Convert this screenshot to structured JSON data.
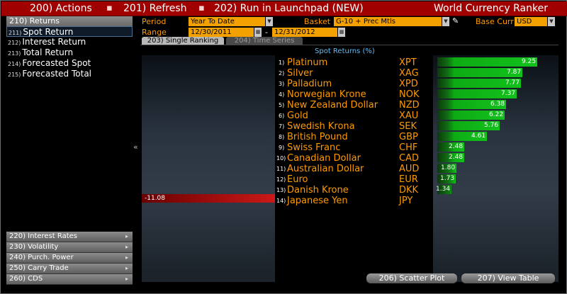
{
  "topbar": {
    "actions": "200) Actions",
    "refresh": "201) Refresh",
    "launchpad": "202) Run in Launchpad (NEW)",
    "app_title": "World Currency Ranker"
  },
  "sidebar": {
    "header": "210) Returns",
    "items": [
      {
        "num": "211)",
        "label": "Spot Return"
      },
      {
        "num": "212)",
        "label": "Interest Return"
      },
      {
        "num": "213)",
        "label": "Total Return"
      },
      {
        "num": "214)",
        "label": "Forecasted Spot"
      },
      {
        "num": "215)",
        "label": "Forecasted Total"
      }
    ],
    "bottom": [
      "220) Interest Rates",
      "230) Volatility",
      "240) Purch. Power",
      "250) Carry Trade",
      "260) CDS"
    ]
  },
  "controls": {
    "period_label": "Period",
    "period_value": "Year To Date",
    "range_label": "Range",
    "range_start": "12/30/2011",
    "range_dash": "-",
    "range_end": "12/31/2012",
    "basket_label": "Basket",
    "basket_value": "G-10 + Prec Mtls",
    "basecurr_label": "Base Curr",
    "basecurr_value": "USD"
  },
  "tabs": {
    "single": "203) Single Ranking",
    "timeseries": "204) Time Series"
  },
  "chart_data": {
    "type": "bar",
    "title": "Spot Returns (%)",
    "xlim": [
      -11.08,
      9.25
    ],
    "rows": [
      {
        "rank": "1)",
        "name": "Platinum",
        "code": "XPT",
        "value": 9.25,
        "label": "9.25"
      },
      {
        "rank": "2)",
        "name": "Silver",
        "code": "XAG",
        "value": 7.87,
        "label": "7.87"
      },
      {
        "rank": "3)",
        "name": "Palladium",
        "code": "XPD",
        "value": 7.77,
        "label": "7.77"
      },
      {
        "rank": "4)",
        "name": "Norwegian Krone",
        "code": "NOK",
        "value": 7.37,
        "label": "7.37"
      },
      {
        "rank": "5)",
        "name": "New Zealand Dollar",
        "code": "NZD",
        "value": 6.38,
        "label": "6.38"
      },
      {
        "rank": "6)",
        "name": "Gold",
        "code": "XAU",
        "value": 6.22,
        "label": "6.22"
      },
      {
        "rank": "7)",
        "name": "Swedish Krona",
        "code": "SEK",
        "value": 5.76,
        "label": "5.76"
      },
      {
        "rank": "8)",
        "name": "British Pound",
        "code": "GBP",
        "value": 4.61,
        "label": "4.61"
      },
      {
        "rank": "9)",
        "name": "Swiss Franc",
        "code": "CHF",
        "value": 2.48,
        "label": "2.48"
      },
      {
        "rank": "10)",
        "name": "Canadian Dollar",
        "code": "CAD",
        "value": 2.48,
        "label": "2.48"
      },
      {
        "rank": "11)",
        "name": "Australian Dollar",
        "code": "AUD",
        "value": 1.8,
        "label": "1.80"
      },
      {
        "rank": "12)",
        "name": "Euro",
        "code": "EUR",
        "value": 1.73,
        "label": "1.73"
      },
      {
        "rank": "13)",
        "name": "Danish Krone",
        "code": "DKK",
        "value": 1.34,
        "label": "1.34"
      },
      {
        "rank": "14)",
        "name": "Japanese Yen",
        "code": "JPY",
        "value": -11.08,
        "label": "-11.08"
      }
    ]
  },
  "buttons": {
    "scatter": "206) Scatter Plot",
    "viewtable": "207) View Table"
  },
  "colors": {
    "title_bar": "#a00000",
    "accent_orange": "#ff9a00",
    "field_orange": "#f3a100",
    "positive_bar": "#12c11b",
    "negative_bar": "#cc1818",
    "chart_title": "#5cc0ff"
  }
}
